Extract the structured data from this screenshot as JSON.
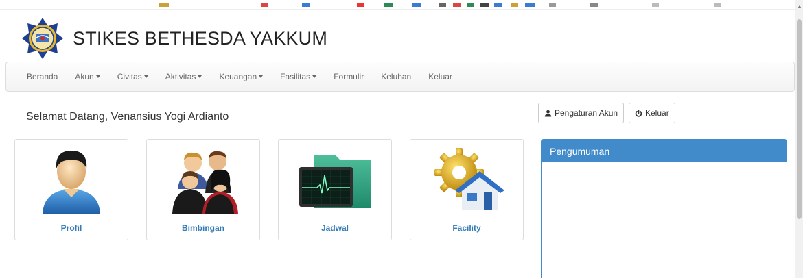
{
  "brand": {
    "title": "STIKES BETHESDA YAKKUM",
    "logo_icon": "bethesda-seal-icon"
  },
  "nav": {
    "items": [
      {
        "label": "Beranda",
        "dropdown": false
      },
      {
        "label": "Akun",
        "dropdown": true
      },
      {
        "label": "Civitas",
        "dropdown": true
      },
      {
        "label": "Aktivitas",
        "dropdown": true
      },
      {
        "label": "Keuangan",
        "dropdown": true
      },
      {
        "label": "Fasilitas",
        "dropdown": true
      },
      {
        "label": "Formulir",
        "dropdown": false
      },
      {
        "label": "Keluhan",
        "dropdown": false
      },
      {
        "label": "Keluar",
        "dropdown": false
      }
    ]
  },
  "welcome": "Selamat Datang, Venansius Yogi Ardianto",
  "buttons": {
    "settings_label": "Pengaturan Akun",
    "settings_icon": "user-icon",
    "logout_label": "Keluar",
    "logout_icon": "power-icon"
  },
  "tiles": [
    {
      "label": "Profil",
      "icon": "person-icon"
    },
    {
      "label": "Bimbingan",
      "icon": "group-icon"
    },
    {
      "label": "Jadwal",
      "icon": "monitor-folder-icon"
    },
    {
      "label": "Facility",
      "icon": "gear-house-icon"
    }
  ],
  "announcement": {
    "title": "Pengumuman"
  },
  "colors": {
    "primary": "#428bca",
    "link": "#337ab7",
    "navbar_border": "#dddddd"
  }
}
